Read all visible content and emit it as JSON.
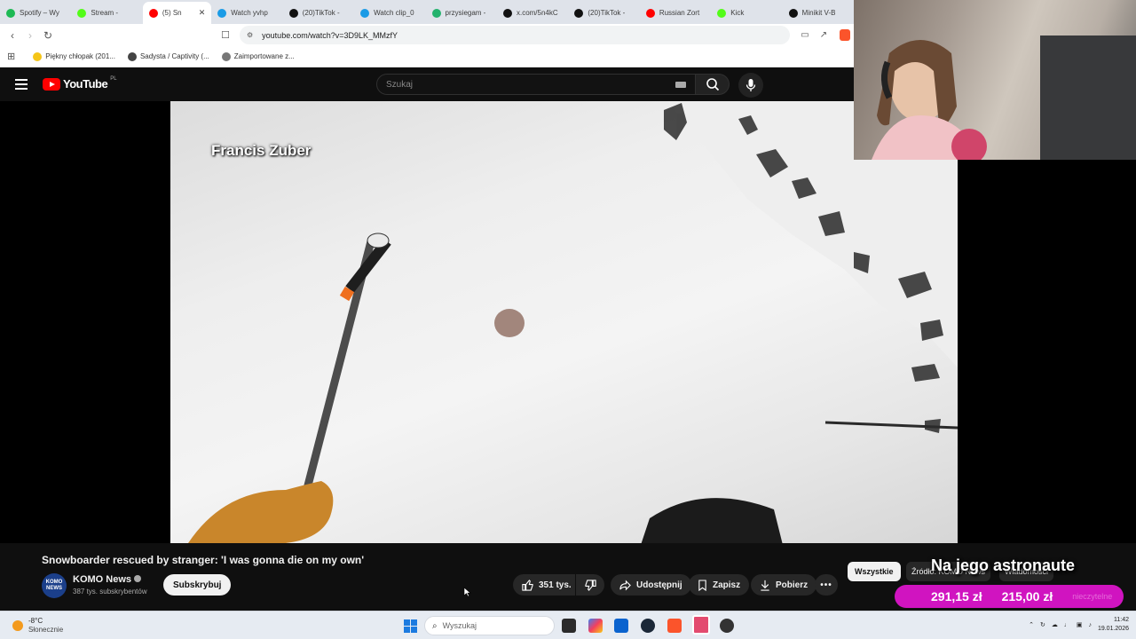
{
  "tabs": [
    {
      "label": "Spotify – Wy",
      "icon": "spotify-icon",
      "color": "#1db954"
    },
    {
      "label": "Stream -",
      "icon": "kick-icon",
      "color": "#53fc18"
    },
    {
      "label": "(5) Sn",
      "icon": "youtube-icon",
      "color": "#ff0000",
      "active": true
    },
    {
      "label": "Watch yvhp",
      "icon": "globe-icon",
      "color": "#1a9be6"
    },
    {
      "label": "(20)TikTok -",
      "icon": "tiktok-icon",
      "color": "#111111"
    },
    {
      "label": "Watch clip_0",
      "icon": "globe-icon",
      "color": "#1a9be6"
    },
    {
      "label": "przysiegam -",
      "icon": "chat-icon",
      "color": "#23b26d"
    },
    {
      "label": "x.com/5n4kC",
      "icon": "x-icon",
      "color": "#111111"
    },
    {
      "label": "(20)TikTok -",
      "icon": "tiktok-icon",
      "color": "#111111"
    },
    {
      "label": "Russian Zort",
      "icon": "youtube-icon",
      "color": "#ff0000"
    },
    {
      "label": "Kick",
      "icon": "kick-icon",
      "color": "#53fc18"
    },
    {
      "label": "Minikit V-B",
      "icon": "tiktok-icon",
      "color": "#111111"
    }
  ],
  "address": {
    "url": "youtube.com/watch?v=3D9LK_MMzfY"
  },
  "bookmarks": [
    {
      "label": "Piękny chłopak (201...",
      "color": "#f5c518"
    },
    {
      "label": "Sadysta / Captivity (...",
      "color": "#444444"
    },
    {
      "label": "Zaimportowane z...",
      "color": "#777777"
    }
  ],
  "youtube": {
    "logo_word": "YouTube",
    "region": "PL",
    "search_placeholder": "Szukaj",
    "video_overlay": "Francis Zuber",
    "title": "Snowboarder rescued by stranger: 'I was gonna die on my own'",
    "channel": {
      "name": "KOMO News",
      "subs": "387 tys. subskrybentów",
      "avatar_text": "KOMO NEWS"
    },
    "subscribe_label": "Subskrybuj",
    "likes": "351 tys.",
    "share_label": "Udostępnij",
    "save_label": "Zapisz",
    "download_label": "Pobierz",
    "more_label": "•••",
    "chips": [
      "Wszystkie",
      "Źródło: KOMO News",
      "Wiadomości"
    ]
  },
  "overlay": {
    "alert_text": "Na jego astronaute",
    "donation_original": "291,15 zł",
    "donation_converted": "215,00 zł",
    "donation_faded": "nieczytelne"
  },
  "taskbar": {
    "weather_temp": "-8°C",
    "weather_desc": "Słonecznie",
    "search_placeholder": "Wyszukaj",
    "time": "11:42",
    "date": "19.01.2026"
  },
  "colors": {
    "youtube_red": "#ff0000",
    "donation": "#d014c0",
    "accent": "#1c7be0"
  }
}
